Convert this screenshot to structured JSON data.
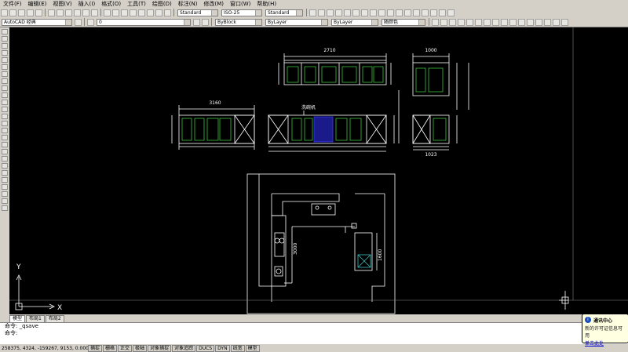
{
  "menu": [
    "文件(F)",
    "编辑(E)",
    "视图(V)",
    "插入(I)",
    "格式(O)",
    "工具(T)",
    "绘图(D)",
    "标注(N)",
    "修改(M)",
    "窗口(W)",
    "帮助(H)"
  ],
  "toolbar": {
    "text_style": "Standard",
    "dim_style": "ISO-25",
    "table_style": "Standard",
    "workspace": "AutoCAD 经典",
    "layer": "0",
    "color": "ByBlock",
    "linetype": "ByLayer",
    "lineweight": "ByLayer",
    "plotstyle": "随颜色"
  },
  "drawing": {
    "top_dim_1": "2710",
    "left_dim_1": "3160",
    "label_appliance": "洗碗机",
    "right_top_dim": "1000",
    "right_bottom_dim": "1023",
    "plan_dim_1": "3000",
    "plan_dim_2": "1600",
    "ucs_y": "Y",
    "ucs_x": "X"
  },
  "tabs": [
    "模型",
    "布局1",
    "布局2"
  ],
  "command": {
    "line1": "命令: _qsave",
    "line2": "命令:"
  },
  "status": {
    "coords": "258375, 4324, -159267, 9153, 0.0000",
    "buttons": [
      "捕捉",
      "栅格",
      "正交",
      "极轴",
      "对象捕捉",
      "对象追踪",
      "DUCS",
      "DYN",
      "线宽",
      "模型"
    ]
  },
  "notification": {
    "title": "通讯中心",
    "body": "新的许可证信息可用",
    "link": "单击此处"
  }
}
